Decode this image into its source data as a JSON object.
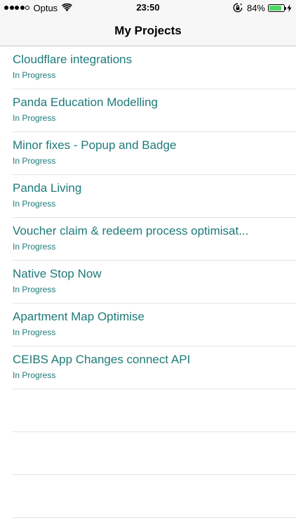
{
  "status_bar": {
    "carrier": "Optus",
    "time": "23:50",
    "battery_percent": "84%",
    "battery_level": 0.84,
    "signal_bars_filled": 4,
    "signal_bars_total": 5,
    "icons": [
      "signal-dots",
      "wifi-icon",
      "rotation-lock-icon",
      "battery-icon",
      "charging-bolt-icon"
    ]
  },
  "nav": {
    "title": "My Projects"
  },
  "projects": [
    {
      "title": "Cloudflare integrations",
      "status": "In Progress"
    },
    {
      "title": "Panda Education Modelling",
      "status": "In Progress"
    },
    {
      "title": "Minor fixes - Popup and Badge",
      "status": "In Progress"
    },
    {
      "title": "Panda Living",
      "status": "In Progress"
    },
    {
      "title": "Voucher claim & redeem process optimisat...",
      "status": "In Progress"
    },
    {
      "title": "Native Stop Now",
      "status": "In Progress"
    },
    {
      "title": "Apartment Map Optimise",
      "status": "In Progress"
    },
    {
      "title": "CEIBS App Changes connect API",
      "status": "In Progress"
    }
  ],
  "colors": {
    "accent_teal": "#1f7a7a",
    "battery_green": "#4cd964",
    "bar_background": "#f7f7f7",
    "separator": "#e3e3e6"
  }
}
